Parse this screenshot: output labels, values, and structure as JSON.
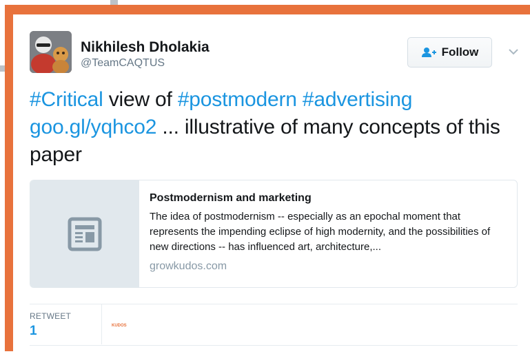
{
  "tweet": {
    "author": {
      "name": "Nikhilesh Dholakia",
      "handle": "@TeamCAQTUS",
      "avatar_icon": "user-photo-avatar"
    },
    "follow_label": "Follow",
    "follow_icon": "add-user-icon",
    "more_icon": "chevron-down-icon",
    "text": {
      "tag1": "#Critical",
      "t1": " view of ",
      "tag2": "#postmodern",
      "t2": " ",
      "tag3": "#advertising",
      "t3": " ",
      "link": "goo.gl/yqhco2",
      "t4": " ... illustrative of many concepts of this paper"
    },
    "card": {
      "thumb_icon": "article-icon",
      "title": "Postmodernism and marketing",
      "description": "The idea of postmodernism -- especially as an epochal moment that represents the impending eclipse of high modernity, and the possibilities of new directions -- has influenced art, architecture,...",
      "domain": "growkudos.com"
    },
    "stats": {
      "retweet_label": "RETWEET",
      "retweet_count": "1",
      "retweeter_avatar_text": "KUDOS"
    }
  },
  "colors": {
    "frame": "#e8723c",
    "link": "#1b95e0",
    "text": "#14171a",
    "muted": "#657786"
  }
}
